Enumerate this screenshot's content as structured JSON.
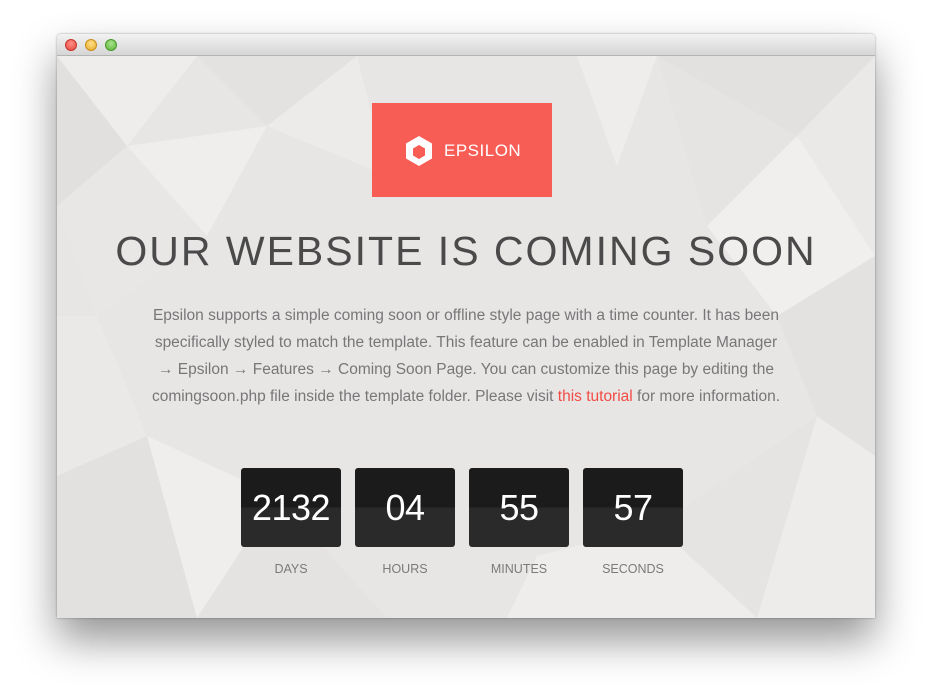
{
  "brand": {
    "name": "EPSILON",
    "color": "#f85d55",
    "icon": "hexagon-logo-icon"
  },
  "headline": "OUR WEBSITE IS COMING SOON",
  "description": {
    "text_before_link": "Epsilon supports a simple coming soon or offline style page with a time counter. It has been specifically styled to match the template. This feature can be enabled in Template Manager → Epsilon → Features → Coming Soon Page. You can customize this page by editing the comingsoon.php file inside the template folder. Please visit ",
    "link_text": "this tutorial",
    "text_after_link": " for more information.",
    "link_color": "#f34b44"
  },
  "countdown": [
    {
      "value": "2132",
      "label": "DAYS"
    },
    {
      "value": "04",
      "label": "HOURS"
    },
    {
      "value": "55",
      "label": "MINUTES"
    },
    {
      "value": "57",
      "label": "SECONDS"
    }
  ]
}
